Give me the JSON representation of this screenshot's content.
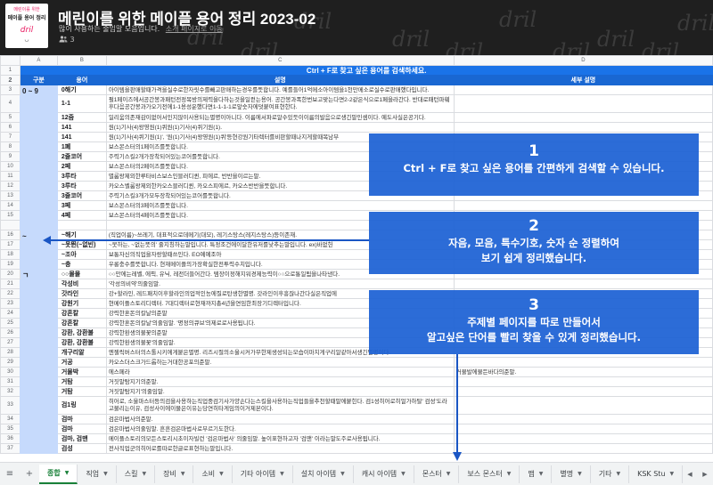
{
  "header": {
    "thumb_line1": "메린이를 위한",
    "thumb_line2": "메이플 용어 정리",
    "thumb_mascot": "dril",
    "thumb_glyph": "ᴗ",
    "title": "메린이를 위한 메이플 용어 정리 2023-02",
    "subtitle": "많이 사용하는 줄임말 모음입니다.",
    "link": "소개 페이지로 이동",
    "viewers_icon": "people-icon",
    "viewers_count": "3",
    "watermark": "dril"
  },
  "columns": [
    "A",
    "B",
    "C",
    "D"
  ],
  "banner": "Ctrl + F로 찾고 싶은 용어를 검색하세요.",
  "headers": {
    "group": "구분",
    "term": "용어",
    "desc": "설명",
    "detail": "세부 설명"
  },
  "groups": [
    {
      "label": "0 ~ 9",
      "start": 0,
      "span": 14
    },
    {
      "label": "~",
      "start": 14,
      "span": 4
    },
    {
      "label": "ㄱ",
      "start": 18,
      "span": 21
    }
  ],
  "rows": [
    {
      "num": "3",
      "term": "0해기",
      "desc": "아이템을판매할때가격을실수로한자릿수를빼고판매하는경우를뜻합니다. 예를들어1억메소아이템을1천만메소로실수로판매했다입니다."
    },
    {
      "num": "4",
      "term": "1-1",
      "desc": "펄1페이즈에서공간봉과패턴전정목방의제력을다하는것을일컫는용어. 공간봉과폭한번보고맞는다면2-2같은식으로1페을라간다. 반대로패턴파훼후다음공간봉과가오기전에1-1용성운했다면1-1-1-1로앞숫자에덧붙여표현한다.",
      "tall": true
    },
    {
      "num": "5",
      "term": "12줌",
      "desc": "일리움의존재감이없어서인지많이사용되는별명이아니다. 이름에서파로알수있듯이이름의발음으로생긴말인셈이다. 예도사실은공기다."
    },
    {
      "num": "6",
      "term": "141",
      "desc": "원(1)기사(4)왕영원(1)퀴원(1)기사(4)퀴기원(1)."
    },
    {
      "num": "7",
      "term": "141",
      "desc": "원(1)기사(4)퀴기원(1)', '원(1)기사(4)왕영원(1)퀴'등현강원기타렉터를비판할때나지게할때복남부"
    },
    {
      "num": "8",
      "term": "1폐",
      "desc": "보스몬스터의1페이즈를뜻합니다."
    },
    {
      "num": "9",
      "term": "2줄코어",
      "desc": "주력기스킬2개가장착되어있는코어를뜻합니다."
    },
    {
      "num": "10",
      "term": "2페",
      "desc": "보스몬스터의2페이즈를뜻합니다."
    },
    {
      "num": "11",
      "term": "3루타",
      "desc": "별룸왕제외한루타비스보스인블러디퀸, 피에르, 반반을이르는말."
    },
    {
      "num": "12",
      "term": "3루타",
      "desc": "카오스벨룸왕제외한카오스블러디퀸, 카오스피에르, 카오스반반을뜻합니다."
    },
    {
      "num": "13",
      "term": "3줄코어",
      "desc": "주력기스킬3개가모두장착되어있는코어를뜻합니다."
    },
    {
      "num": "14",
      "term": "3페",
      "desc": "보스몬스터의3페이즈를뜻합니다."
    },
    {
      "num": "15",
      "term": "4페",
      "desc": "보스몬스터의4페이즈를뜻합니다."
    },
    {
      "num": "",
      "term": "",
      "desc": ""
    },
    {
      "num": "16",
      "term": "~해기",
      "desc": "(직업이름)~쓰레기, 대표적으로데메기(대모), 레기스탕스(레지스탕스)등이존재."
    },
    {
      "num": "17",
      "term": "~못뛴(~없빈)",
      "desc": "~못하는, ~없는뜻의' 줄지칭하는말입니다. 특정조건에이달한유저를낮추는말입니다. ex)바없헌"
    },
    {
      "num": "18",
      "term": "~조아",
      "desc": "보통자신의직업을자랑할때쓰인다. EO예예조아"
    },
    {
      "num": "19",
      "term": "~충",
      "desc": "우롱충수를뜻합니다. 현재메이플의가장확실한전투력수치입니다."
    },
    {
      "num": "20",
      "term": "○○몰몰",
      "desc": "○○만에는레벨, 에픽, 유닉, 레전더들어간다. 템장이정해지워경제능력이○○으로통일됨을나타낸다."
    },
    {
      "num": "21",
      "term": "각성비",
      "desc": "'각성의비약'의줄임말."
    },
    {
      "num": "22",
      "term": "갓라인",
      "desc": "강+할라인, 레드패치이후할라인의업적인능에질로탄생한별명. 갓라인이후흥잖나간다실은직업에"
    },
    {
      "num": "23",
      "term": "강원기",
      "desc": "현메이플스토리디렉터. 7대디렉터로현재까지총4년을연임한최장기디렉터입니다."
    },
    {
      "num": "24",
      "term": "강흔칼",
      "desc": "강력한혼돈의칼날의준말"
    },
    {
      "num": "25",
      "term": "강흔칼",
      "desc": "강력한혼돈의칼날'의줄임말. '명정의큐브'의제로로사용됩니다."
    },
    {
      "num": "26",
      "term": "강환, 강환불",
      "desc": "강력한환생의불꽃의준말"
    },
    {
      "num": "27",
      "term": "강환, 강환불",
      "desc": "강력한환생의불꽃'의줄임말."
    },
    {
      "num": "28",
      "term": "개구리알",
      "desc": "엔젤릭버스터의스톨시키에게붙은별명. 리즈시절의소울시커가무한제생성되는모습이마치게구리알같아서생긴별명이다."
    },
    {
      "num": "29",
      "term": "거공",
      "desc": "카오스더스크가드롭하는거대한공포의준말."
    },
    {
      "num": "30",
      "term": "거물박",
      "desc": "에스페라",
      "detail": "거물발에물든바다의준말."
    },
    {
      "num": "31",
      "term": "거탐",
      "desc": "거짓말탐지기의준말."
    },
    {
      "num": "32",
      "term": "거탐",
      "desc": "거짓말탐지기'의줄임말."
    },
    {
      "num": "33",
      "term": "검1링",
      "desc": "히어로, 소울마스터등의검을사용하는직업중검기사가양손다는스킬을사용하는직업들을추천할때말에붙힌다. 검1성히어로히얼가하탈' 검성'도라고불리는이유, 검성사이에이물은이유는당연히타게임의이거제본이다.",
      "tall": true
    },
    {
      "num": "34",
      "term": "검마",
      "desc": "검은마법사의준말."
    },
    {
      "num": "35",
      "term": "검마",
      "desc": "검은마법사의줄임말. 흔흔검은마법사로부르기도한다."
    },
    {
      "num": "36",
      "term": "검마, 검맨",
      "desc": "메이플스토리의모든스토리시초이자빌런 '검은마법사' 의줄임말. 높이표현하고자 '검맨' 이라는말도주로사용됩니다."
    },
    {
      "num": "37",
      "term": "검성",
      "desc": "전사직업군의히어로를따로한글로표현하는말입니다."
    }
  ],
  "overlays": [
    {
      "num": "1",
      "lines": [
        "Ctrl + F로 찾고 싶은 용어를 간편하게 검색할 수 있습니다."
      ]
    },
    {
      "num": "2",
      "lines": [
        "자음, 모음, 특수기호, 숫자 순 정렬하여",
        "보기 쉽게 정리했습니다."
      ]
    },
    {
      "num": "3",
      "lines": [
        "주제별 페이지를 따로 만들어서",
        "알고싶은 단어를 빨리 찾을 수 있게 정리했습니다."
      ]
    }
  ],
  "tabs": {
    "menu_icon": "menu-icon",
    "add_icon": "add-sheet-icon",
    "active_index": 0,
    "items": [
      "종합",
      "직업",
      "스킬",
      "장비",
      "소비",
      "기타 아이템",
      "설치 아이템",
      "캐시 아이템",
      "몬스터",
      "보스 몬스터",
      "맵",
      "별명",
      "기타",
      "KSK Stu"
    ]
  },
  "colors": {
    "header_bg": "#1f1f1f",
    "banner": "#1a73e8",
    "group_bg": "#c6dafc",
    "overlay": "#1c61d4",
    "active_tab": "#188038"
  }
}
